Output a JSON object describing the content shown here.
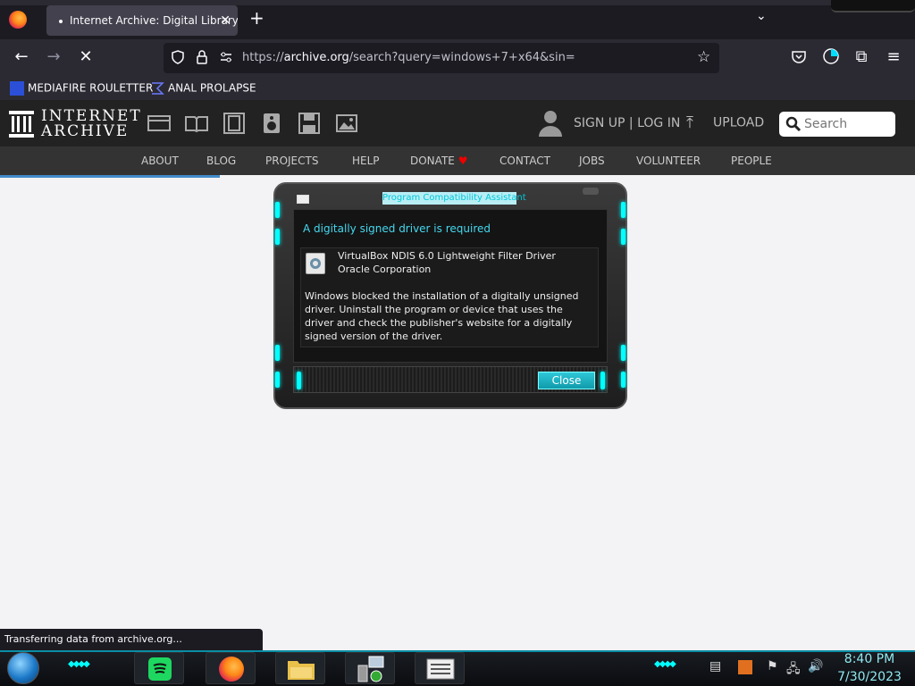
{
  "browser": {
    "tab_title": "Internet Archive: Digital Library of Free & Borrowable Books, Movies, Music & Wayback Machine",
    "tab_close": "✕",
    "new_tab": "+",
    "tab_list": "⌄",
    "url_prefix": "https://",
    "url_domain": "archive.org",
    "url_path": "/search?query=windows+7+x64&sin=",
    "back": "←",
    "forward": "→",
    "stop": "✕",
    "bookmark_star": "☆",
    "pocket": "⛉",
    "extensions": "⧉",
    "menu": "≡"
  },
  "bookmarks": [
    {
      "label": "MEDIAFIRE ROULETTER",
      "icon": "mediafire-icon"
    },
    {
      "label": "ANAL PROLAPSE",
      "icon": "sigma-icon"
    }
  ],
  "ia": {
    "logo_line1": "INTERNET",
    "logo_line2": "ARCHIVE",
    "sign_in": "SIGN UP | LOG IN",
    "upload": "UPLOAD",
    "search_placeholder": "Search",
    "nav": [
      "ABOUT",
      "BLOG",
      "PROJECTS",
      "HELP",
      "DONATE",
      "CONTACT",
      "JOBS",
      "VOLUNTEER",
      "PEOPLE"
    ],
    "donate_heart": "♥",
    "load_progress": 0.24
  },
  "dialog": {
    "title": "Program Compatibility Assistant",
    "heading": "A digitally signed driver is required",
    "driver_name": "VirtualBox NDIS 6.0 Lightweight Filter Driver",
    "publisher": "Oracle Corporation",
    "message": "Windows blocked the installation of a digitally unsigned driver.  Uninstall the program or device that uses the driver and check the publisher's website for a digitally signed version of the driver.",
    "close_label": "Close"
  },
  "status_text": "Transferring data from archive.org...",
  "taskbar": {
    "time": "8:40 PM",
    "date": "7/30/2023",
    "apps": [
      "spotify-icon",
      "firefox-icon",
      "file-explorer-icon",
      "network-device-icon",
      "notepad-icon"
    ]
  }
}
